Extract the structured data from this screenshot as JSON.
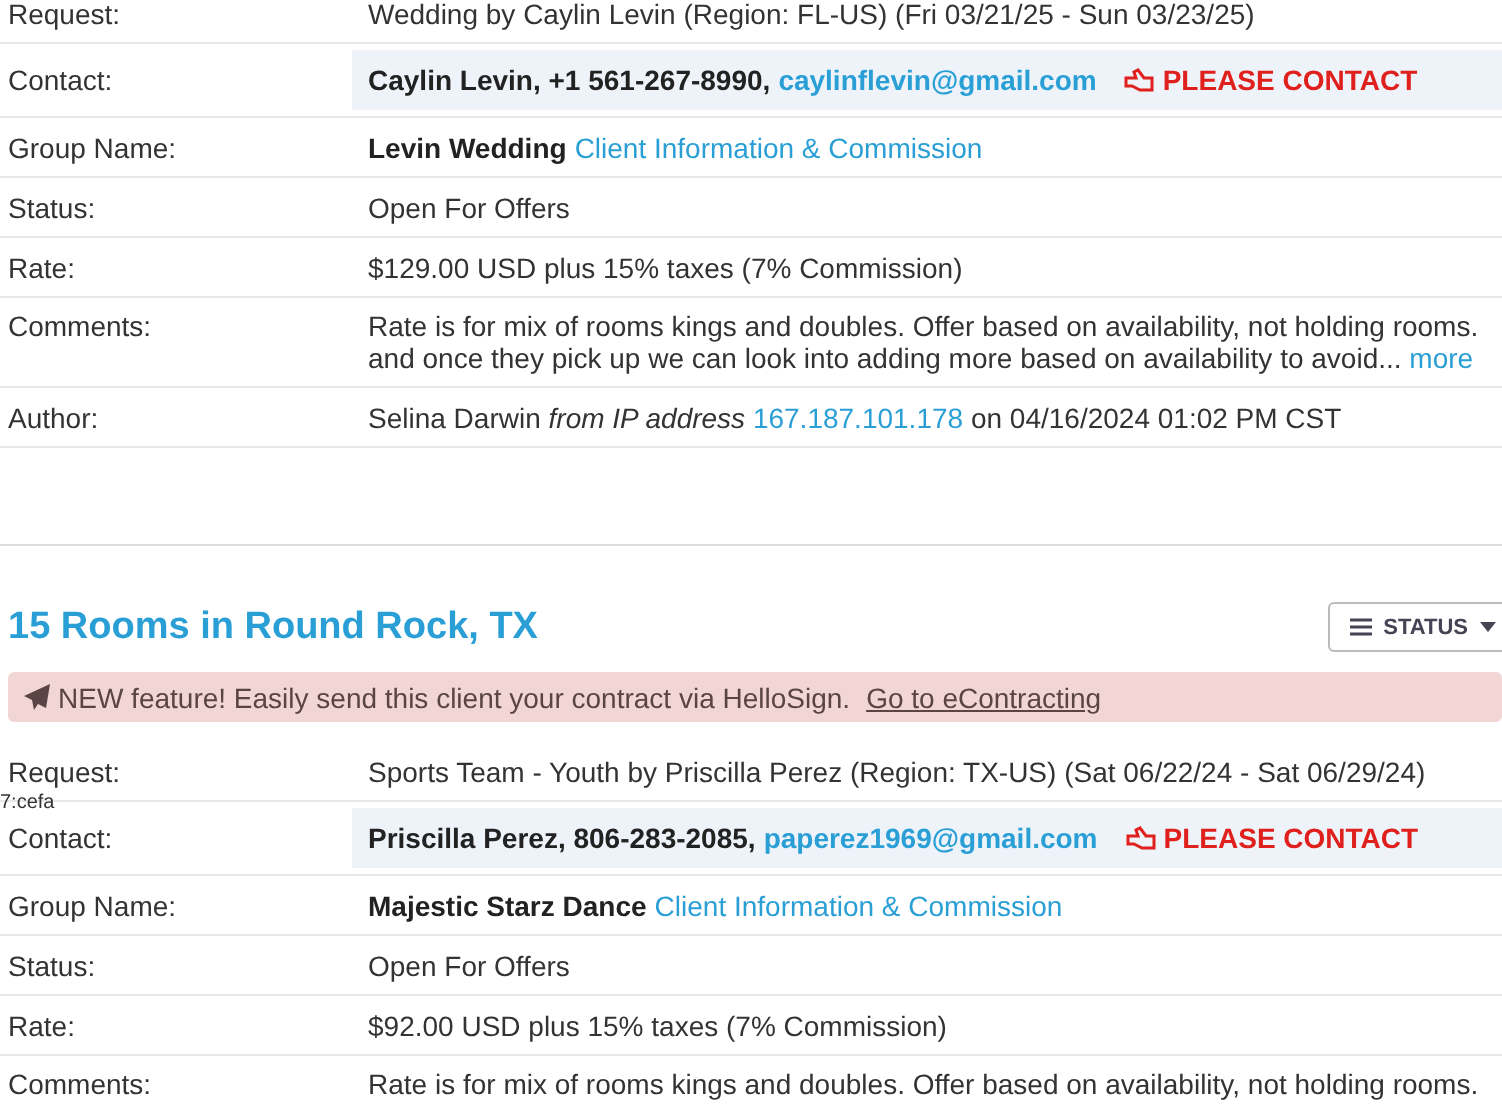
{
  "listings": [
    {
      "rows": [
        {
          "kind": "text",
          "label": "Request:",
          "value": "Wedding by Caylin Levin (Region: FL-US) (Fri 03/21/25 - Sun 03/23/25)"
        },
        {
          "kind": "contact",
          "label": "Contact:",
          "name": "Caylin Levin, +1 561-267-8990,",
          "email": "caylinflevin@gmail.com",
          "alert": "PLEASE CONTACT"
        },
        {
          "kind": "group",
          "label": "Group Name:",
          "name": "Levin Wedding",
          "link": "Client Information & Commission"
        },
        {
          "kind": "text",
          "label": "Status:",
          "value": "Open For Offers"
        },
        {
          "kind": "text",
          "label": "Rate:",
          "value": "$129.00 USD plus 15% taxes (7% Commission)"
        },
        {
          "kind": "comments",
          "label": "Comments:",
          "line_1": "Rate is for mix of rooms kings and doubles. Offer based on availability, not holding rooms.",
          "line_2": "and once they pick up we can look into adding more based on availability to avoid...",
          "more": "more"
        },
        {
          "kind": "author",
          "label": "Author:",
          "name": "Selina Darwin",
          "via": "from IP address",
          "ip": "167.187.101.178",
          "date": "on 04/16/2024 01:02 PM CST"
        }
      ]
    },
    {
      "title": "15 Rooms in  Round Rock, TX",
      "status_button": "STATUS",
      "banner": {
        "text": "NEW feature! Easily send this client your contract via HelloSign.",
        "link": "Go to eContracting"
      },
      "overlay_note": "7:cefa",
      "rows": [
        {
          "kind": "text",
          "label": "Request:",
          "value": "Sports Team - Youth by Priscilla Perez (Region: TX-US) (Sat 06/22/24 - Sat 06/29/24)"
        },
        {
          "kind": "contact",
          "label": "Contact:",
          "name": "Priscilla Perez, 806-283-2085,",
          "email": "paperez1969@gmail.com",
          "alert": "PLEASE CONTACT"
        },
        {
          "kind": "group",
          "label": "Group Name:",
          "name": "Majestic Starz Dance",
          "link": "Client Information & Commission"
        },
        {
          "kind": "text",
          "label": "Status:",
          "value": "Open For Offers"
        },
        {
          "kind": "text",
          "label": "Rate:",
          "value": "$92.00 USD plus 15% taxes (7% Commission)"
        },
        {
          "kind": "comments",
          "label": "Comments:",
          "line_1": "Rate is for mix of rooms kings and doubles. Offer based on availability, not holding rooms."
        }
      ]
    }
  ]
}
